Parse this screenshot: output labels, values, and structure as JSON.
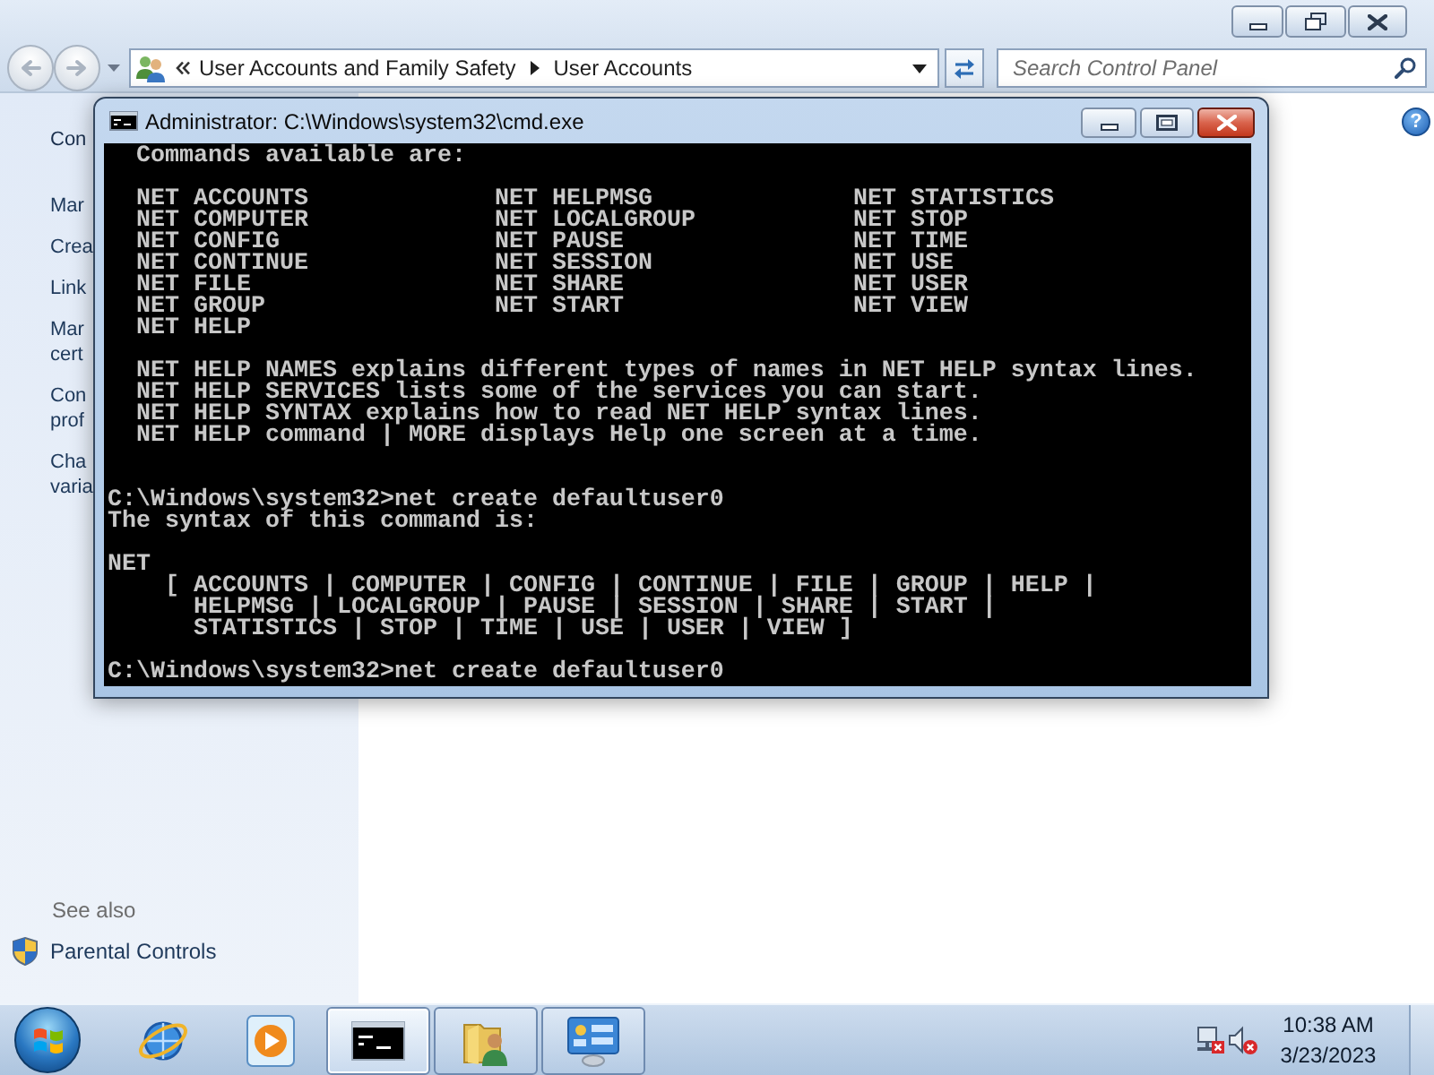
{
  "control_panel": {
    "active": false,
    "window_buttons": [
      {
        "kind": "minimize"
      },
      {
        "kind": "restore"
      },
      {
        "kind": "close"
      }
    ],
    "navigation": {
      "back_button": {
        "disabled": true
      },
      "forward_button": {
        "disabled": true
      },
      "address_bar": {
        "breadcrumbs": [
          "User Accounts and Family Safety",
          "User Accounts"
        ]
      },
      "search": {
        "placeholder": "Search Control Panel"
      }
    },
    "sidebar": {
      "home_link": {
        "lines": [
          "Con"
        ]
      },
      "tasks": [
        {
          "lines": [
            "Mar"
          ]
        },
        {
          "lines": [
            "Crea"
          ]
        },
        {
          "lines": [
            "Link"
          ]
        },
        {
          "lines": [
            "Mar",
            "cert"
          ]
        },
        {
          "lines": [
            "Con",
            "prof"
          ]
        },
        {
          "lines": [
            "Cha",
            "varia"
          ]
        }
      ],
      "see_also": {
        "heading": "See also",
        "links": [
          {
            "label": "Parental Controls"
          }
        ]
      }
    },
    "help_button": {
      "label": "?"
    }
  },
  "console_window": {
    "active": true,
    "title": "Administrator: C:\\Windows\\system32\\cmd.exe",
    "window_buttons": [
      {
        "kind": "minimize"
      },
      {
        "kind": "maximize"
      },
      {
        "kind": "close"
      }
    ],
    "blocks": [
      {
        "kind": "heading",
        "lines": [
          "Commands available are:"
        ]
      },
      {
        "kind": "columns",
        "columns": [
          [
            "NET ACCOUNTS",
            "NET COMPUTER",
            "NET CONFIG",
            "NET CONTINUE",
            "NET FILE",
            "NET GROUP",
            "NET HELP"
          ],
          [
            "NET HELPMSG",
            "NET LOCALGROUP",
            "NET PAUSE",
            "NET SESSION",
            "NET SHARE",
            "NET START"
          ],
          [
            "NET STATISTICS",
            "NET STOP",
            "NET TIME",
            "NET USE",
            "NET USER",
            "NET VIEW"
          ]
        ]
      },
      {
        "kind": "notes",
        "lines": [
          "NET HELP NAMES explains different types of names in NET HELP syntax lines.",
          "NET HELP SERVICES lists some of the services you can start.",
          "NET HELP SYNTAX explains how to read NET HELP syntax lines.",
          "NET HELP command | MORE displays Help one screen at a time."
        ]
      },
      {
        "kind": "command",
        "command_line": "C:\\Windows\\system32>net create defaultuser0",
        "output": [
          "The syntax of this command is:"
        ]
      },
      {
        "kind": "syntax",
        "command": "NET",
        "options": [
          "[ ACCOUNTS | COMPUTER | CONFIG | CONTINUE | FILE | GROUP | HELP |",
          "HELPMSG | LOCALGROUP | PAUSE | SESSION | SHARE | START |",
          "STATISTICS | STOP | TIME | USE | USER | VIEW ]"
        ]
      },
      {
        "kind": "command",
        "command_line": "C:\\Windows\\system32>net create defaultuser0"
      }
    ]
  },
  "taskbar": {
    "buttons": [
      {
        "kind": "browser",
        "running": false,
        "selected": false
      },
      {
        "kind": "media",
        "running": false,
        "selected": false
      },
      {
        "kind": "console",
        "running": true,
        "selected": true
      },
      {
        "kind": "folder",
        "running": true,
        "selected": false
      },
      {
        "kind": "settings",
        "running": true,
        "selected": false
      }
    ],
    "tray": {
      "network_connected": false,
      "volume_muted": true
    },
    "clock": {
      "time": "10:38 AM",
      "date": "3/23/2023"
    }
  }
}
